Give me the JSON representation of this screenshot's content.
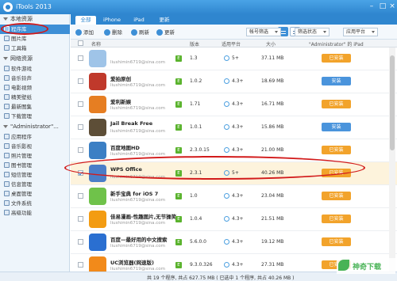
{
  "window": {
    "title": "iTools 2013"
  },
  "sidebar": {
    "sections": [
      {
        "label": "本地资源",
        "items": [
          {
            "label": "程序库",
            "active": true
          },
          {
            "label": "图片库"
          },
          {
            "label": "工具箱"
          }
        ]
      },
      {
        "label": "网络资源",
        "items": [
          {
            "label": "软件游戏"
          },
          {
            "label": "音乐铃声"
          },
          {
            "label": "电影视频"
          },
          {
            "label": "精美壁纸"
          },
          {
            "label": "最新图集"
          },
          {
            "label": "下载管理"
          }
        ]
      },
      {
        "label": "\"Administrator\"...",
        "items": [
          {
            "label": "应用程序"
          },
          {
            "label": "音乐影视"
          },
          {
            "label": "照片管理"
          },
          {
            "label": "图书管理"
          },
          {
            "label": "短信管理"
          },
          {
            "label": "信息管理"
          },
          {
            "label": "桌面管理"
          },
          {
            "label": "文件系统"
          },
          {
            "label": "高级功能"
          }
        ]
      }
    ]
  },
  "tabs": [
    "全部",
    "iPhone",
    "iPad",
    "更新"
  ],
  "toolbar": {
    "add": "添加",
    "delete": "删除",
    "refresh": "刷新",
    "update": "更新",
    "filter_account": "帐号筛选",
    "filter_status": "筛选状态",
    "filter_platform": "应用平台"
  },
  "columns": {
    "name": "名称",
    "version": "版本",
    "platform": "适用平台",
    "size": "大小",
    "device": "\"Administrator\" 的 iPad"
  },
  "apps": [
    {
      "name": "",
      "account": "liushimin6719@sina.com",
      "version": "1.3",
      "platform": "5+",
      "size": "37.11 MB",
      "action": "已安装",
      "state": "installed",
      "checked": false,
      "color": "#9fc4e8"
    },
    {
      "name": "爱拍原创",
      "account": "liushimin6719@sina.com",
      "version": "1.0.2",
      "platform": "4.3+",
      "size": "18.69 MB",
      "action": "安装",
      "state": "install",
      "checked": false,
      "color": "#c0392b"
    },
    {
      "name": "爱利新娱",
      "account": "liushimin6719@sina.com",
      "version": "1.71",
      "platform": "4.3+",
      "size": "16.71 MB",
      "action": "已安装",
      "state": "installed",
      "checked": false,
      "color": "#e67e22"
    },
    {
      "name": "Jail Break Free",
      "account": "liushimin6719@sina.com",
      "version": "1.0.1",
      "platform": "4.3+",
      "size": "15.86 MB",
      "action": "安装",
      "state": "install",
      "checked": false,
      "color": "#5d4e37"
    },
    {
      "name": "百度地图HD",
      "account": "liushimin6719@sina.com",
      "version": "2.3.0.15",
      "platform": "4.3+",
      "size": "21.00 MB",
      "action": "已安装",
      "state": "installed",
      "checked": false,
      "color": "#3b7fc4"
    },
    {
      "name": "WPS Office",
      "account": "liushimin6719@sina.com",
      "version": "2.3.1",
      "platform": "5+",
      "size": "40.26 MB",
      "action": "已安装",
      "state": "installed",
      "checked": true,
      "color": "#4a7ec8"
    },
    {
      "name": "新手宝典 for iOS 7",
      "account": "liushimin6719@sina.com",
      "version": "1.0",
      "platform": "4.3+",
      "size": "23.04 MB",
      "action": "已安装",
      "state": "installed",
      "checked": false,
      "color": "#6fc24a"
    },
    {
      "name": "佳易漫画-性趣图片,无节操笑...",
      "account": "liushimin6719@sina.com",
      "version": "1.0.4",
      "platform": "4.3+",
      "size": "21.51 MB",
      "action": "已安装",
      "state": "installed",
      "checked": false,
      "color": "#f39c12"
    },
    {
      "name": "百度—最好用的中文搜索",
      "account": "liushimin6719@sina.com",
      "version": "5.6.0.0",
      "platform": "4.3+",
      "size": "19.12 MB",
      "action": "已安装",
      "state": "installed",
      "checked": false,
      "color": "#2a6fd1"
    },
    {
      "name": "UC浏览器(网速版)",
      "account": "liushimin6719@sina.com",
      "version": "9.3.0.326",
      "platform": "4.3+",
      "size": "27.31 MB",
      "action": "已安装",
      "state": "installed",
      "checked": false,
      "color": "#f28a1a"
    }
  ],
  "status": "共 19 个程序, 共占 627.75 MB  ( 已选中 1 个程序, 共占 40.26 MB )",
  "watermark": "神奇下载"
}
